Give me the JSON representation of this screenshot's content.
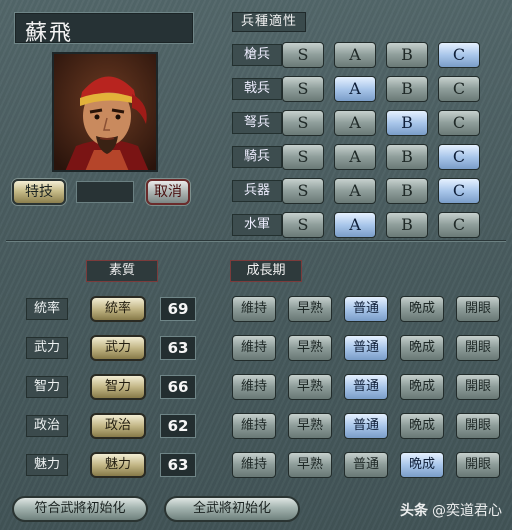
{
  "character": {
    "name": "蘇飛"
  },
  "special": {
    "button": "特技",
    "cancel": "取消",
    "value": ""
  },
  "aptitude": {
    "title": "兵種適性",
    "grades": [
      "S",
      "A",
      "B",
      "C"
    ],
    "rows": [
      {
        "label": "槍兵",
        "selected": "C"
      },
      {
        "label": "戟兵",
        "selected": "A"
      },
      {
        "label": "弩兵",
        "selected": "B"
      },
      {
        "label": "騎兵",
        "selected": "C"
      },
      {
        "label": "兵器",
        "selected": "C"
      },
      {
        "label": "水軍",
        "selected": "A"
      }
    ]
  },
  "headers": {
    "quality": "素質",
    "growth": "成長期"
  },
  "growth_options": [
    "維持",
    "早熟",
    "普通",
    "晩成",
    "開眼"
  ],
  "stats": [
    {
      "label": "統率",
      "button": "統率",
      "value": "69",
      "growth": "普通"
    },
    {
      "label": "武力",
      "button": "武力",
      "value": "63",
      "growth": "普通"
    },
    {
      "label": "智力",
      "button": "智力",
      "value": "66",
      "growth": "普通"
    },
    {
      "label": "政治",
      "button": "政治",
      "value": "62",
      "growth": "普通"
    },
    {
      "label": "魅力",
      "button": "魅力",
      "value": "63",
      "growth": "晩成"
    }
  ],
  "footer": {
    "reset_matching": "符合武將初始化",
    "reset_all": "全武將初始化"
  },
  "watermark": {
    "brand": "头条",
    "account": "@奕道君心"
  },
  "colors": {
    "selected": "#a9c6ea",
    "panel": "#4a5d60"
  }
}
